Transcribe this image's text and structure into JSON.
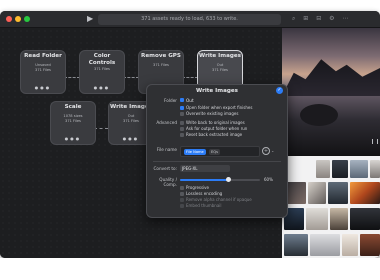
{
  "toolbar": {
    "status_text": "371 assets ready to load, 633 to write.",
    "play_symbol": "▶",
    "tool_icons": "⌕ ⊞ ⊟ ⚙ ⋯"
  },
  "graph": {
    "tab_label": "",
    "nodes": [
      {
        "title": "Read Folder",
        "line1": "Unsaved",
        "line2": "371 Files"
      },
      {
        "title": "Color Controls",
        "line1": "",
        "line2": "371 Files"
      },
      {
        "title": "Remove GPS",
        "line1": "",
        "line2": "371 Files"
      },
      {
        "title": "Write Images",
        "line1": "Out",
        "line2": "371 Files"
      },
      {
        "title": "Scale",
        "line1": "1078 sizes",
        "line2": "371 Files"
      },
      {
        "title": "Write Images",
        "line1": "Out",
        "line2": "371 Files"
      }
    ],
    "node_dots": "●●●"
  },
  "dialog": {
    "title": "Write Images",
    "ok_symbol": "✓",
    "folder_label": "Folder",
    "folder_value": "Out",
    "options": [
      {
        "text": "Open folder when export finishes",
        "checked": true
      },
      {
        "text": "Overwrite existing images",
        "checked": false
      }
    ],
    "advanced_label": "Advanced",
    "advanced_options": [
      {
        "text": "Write back to original images",
        "checked": false
      },
      {
        "text": "Ask for output folder when run",
        "checked": false
      },
      {
        "text": "Reset back extracted image",
        "checked": false
      }
    ],
    "file_name_label": "File name",
    "file_name_tokens": [
      "File Name",
      "EQs"
    ],
    "file_name_plus": "+",
    "file_name_chevron": "⌄",
    "convert_label": "Convert to:",
    "convert_value": "JPEG-XL",
    "quality_label": "Quality / Comp.",
    "quality_value": "60%",
    "quality_fraction": 0.6,
    "format_options": [
      {
        "text": "Progressive",
        "checked": false,
        "enabled": true
      },
      {
        "text": "Lossless encoding",
        "checked": false,
        "enabled": true
      },
      {
        "text": "Remove alpha channel if opaque",
        "checked": false,
        "enabled": false
      },
      {
        "text": "Embed thumbnail",
        "checked": false,
        "enabled": false
      }
    ]
  },
  "colors": {
    "accent": "#2c7cf6",
    "window_bg": "#202123",
    "node_bg": "#3a3b3f",
    "dialog_bg": "#2f3033"
  }
}
